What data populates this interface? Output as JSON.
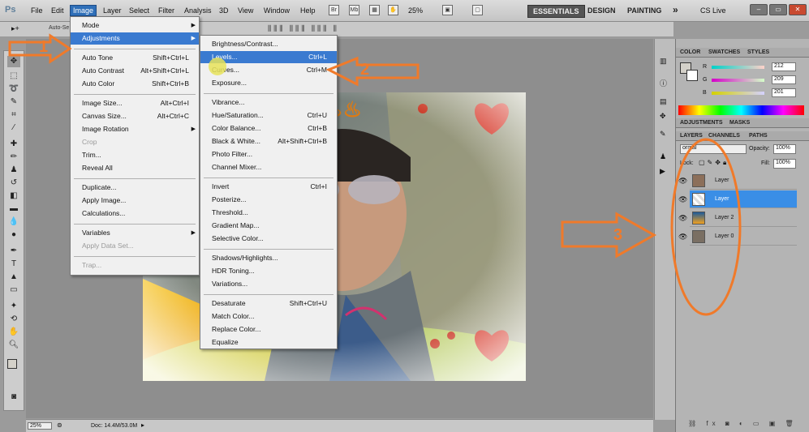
{
  "menubar": {
    "logo": "Ps",
    "items": [
      "File",
      "Edit",
      "Image",
      "Layer",
      "Select",
      "Filter",
      "Analysis",
      "3D",
      "View",
      "Window",
      "Help"
    ],
    "zoom": "25%",
    "workspaces": [
      "ESSENTIALS",
      "DESIGN",
      "PAINTING"
    ],
    "more": "»",
    "cslive": "CS Live",
    "mini_icons": [
      "Br",
      "Mb"
    ]
  },
  "optbar": {
    "auto_select": "Auto-Se"
  },
  "image_menu": [
    {
      "label": "Mode",
      "submenu": true
    },
    {
      "label": "Adjustments",
      "submenu": true,
      "active": true
    },
    {
      "sep": true
    },
    {
      "label": "Auto Tone",
      "shortcut": "Shift+Ctrl+L"
    },
    {
      "label": "Auto Contrast",
      "shortcut": "Alt+Shift+Ctrl+L"
    },
    {
      "label": "Auto Color",
      "shortcut": "Shift+Ctrl+B"
    },
    {
      "sep": true
    },
    {
      "label": "Image Size...",
      "shortcut": "Alt+Ctrl+I"
    },
    {
      "label": "Canvas Size...",
      "shortcut": "Alt+Ctrl+C"
    },
    {
      "label": "Image Rotation",
      "submenu": true
    },
    {
      "label": "Crop",
      "disabled": true
    },
    {
      "label": "Trim..."
    },
    {
      "label": "Reveal All"
    },
    {
      "sep": true
    },
    {
      "label": "Duplicate..."
    },
    {
      "label": "Apply Image..."
    },
    {
      "label": "Calculations..."
    },
    {
      "sep": true
    },
    {
      "label": "Variables",
      "submenu": true
    },
    {
      "label": "Apply Data Set...",
      "disabled": true
    },
    {
      "sep": true
    },
    {
      "label": "Trap...",
      "disabled": true
    }
  ],
  "adjustments_menu": [
    {
      "label": "Brightness/Contrast..."
    },
    {
      "label": "Levels...",
      "shortcut": "Ctrl+L",
      "highlight": true
    },
    {
      "label": "Curves...",
      "shortcut": "Ctrl+M"
    },
    {
      "label": "Exposure..."
    },
    {
      "sep": true
    },
    {
      "label": "Vibrance..."
    },
    {
      "label": "Hue/Saturation...",
      "shortcut": "Ctrl+U"
    },
    {
      "label": "Color Balance...",
      "shortcut": "Ctrl+B"
    },
    {
      "label": "Black & White...",
      "shortcut": "Alt+Shift+Ctrl+B"
    },
    {
      "label": "Photo Filter..."
    },
    {
      "label": "Channel Mixer..."
    },
    {
      "sep": true
    },
    {
      "label": "Invert",
      "shortcut": "Ctrl+I"
    },
    {
      "label": "Posterize..."
    },
    {
      "label": "Threshold..."
    },
    {
      "label": "Gradient Map..."
    },
    {
      "label": "Selective Color..."
    },
    {
      "sep": true
    },
    {
      "label": "Shadows/Highlights..."
    },
    {
      "label": "HDR Toning..."
    },
    {
      "label": "Variations..."
    },
    {
      "sep": true
    },
    {
      "label": "Desaturate",
      "shortcut": "Shift+Ctrl+U"
    },
    {
      "label": "Match Color..."
    },
    {
      "label": "Replace Color..."
    },
    {
      "label": "Equalize"
    }
  ],
  "color_panel": {
    "tabs": [
      "COLOR",
      "SWATCHES",
      "STYLES"
    ],
    "r_label": "R",
    "g_label": "G",
    "b_label": "B",
    "r": "212",
    "g": "209",
    "b": "201"
  },
  "adjust_panel": {
    "tabs": [
      "ADJUSTMENTS",
      "MASKS"
    ]
  },
  "layers_panel": {
    "tabs": [
      "LAYERS",
      "CHANNELS",
      "PATHS"
    ],
    "blend_mode": "ormal",
    "opacity_label": "Opacity:",
    "opacity": "100%",
    "lock_label": "Lock:",
    "fill_label": "Fill:",
    "fill": "100%",
    "layers": [
      {
        "name": "Layer",
        "selected": false
      },
      {
        "name": "Layer",
        "selected": true
      },
      {
        "name": "Layer 2",
        "selected": false
      },
      {
        "name": "Layer 0",
        "selected": false
      }
    ]
  },
  "statusbar": {
    "zoom": "25%",
    "doc": "Doc: 14.4M/53.0M"
  },
  "callouts": [
    "1",
    "2",
    "3"
  ],
  "colors": {
    "accent": "#f07a2a",
    "highlight": "#3a7ad0",
    "selected_layer": "#3a8ee6"
  }
}
